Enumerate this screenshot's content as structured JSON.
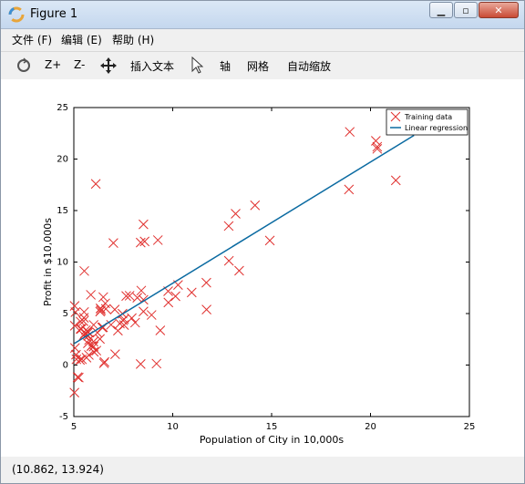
{
  "window": {
    "title": "Figure 1"
  },
  "menu": [
    {
      "label": "文件 (F)"
    },
    {
      "label": "编辑 (E)"
    },
    {
      "label": "帮助 (H)"
    }
  ],
  "toolbar": {
    "zoom_in": "Z+",
    "zoom_out": "Z-",
    "insert_text": "插入文本",
    "axes": "轴",
    "grid": "网格",
    "autoscale": "自动缩放"
  },
  "status": {
    "coords": "(10.862, 13.924)"
  },
  "colors": {
    "training": "#e0302e",
    "regression": "#0a6aa1"
  },
  "chart_data": {
    "type": "scatter",
    "xlabel": "Population of City in 10,000s",
    "ylabel": "Profit in $10,000s",
    "xlim": [
      5,
      25
    ],
    "ylim": [
      -5,
      25
    ],
    "xticks": [
      5,
      10,
      15,
      20,
      25
    ],
    "yticks": [
      -5,
      0,
      5,
      10,
      15,
      20,
      25
    ],
    "legend_position": "top-right",
    "series": [
      {
        "name": "Training data",
        "kind": "scatter",
        "marker": "x",
        "points": [
          [
            6.11,
            17.59
          ],
          [
            5.53,
            9.13
          ],
          [
            8.52,
            13.66
          ],
          [
            7.0,
            11.85
          ],
          [
            5.86,
            6.82
          ],
          [
            8.38,
            11.89
          ],
          [
            7.48,
            4.35
          ],
          [
            8.58,
            12.0
          ],
          [
            6.49,
            6.6
          ],
          [
            5.05,
            3.82
          ],
          [
            5.71,
            3.25
          ],
          [
            14.16,
            15.51
          ],
          [
            5.73,
            3.16
          ],
          [
            8.41,
            7.23
          ],
          [
            5.64,
            0.72
          ],
          [
            5.38,
            3.51
          ],
          [
            6.37,
            5.3
          ],
          [
            5.13,
            0.56
          ],
          [
            6.43,
            3.65
          ],
          [
            7.07,
            5.39
          ],
          [
            6.19,
            3.14
          ],
          [
            20.27,
            21.77
          ],
          [
            5.49,
            4.26
          ],
          [
            6.33,
            5.19
          ],
          [
            5.56,
            3.08
          ],
          [
            18.95,
            22.64
          ],
          [
            12.83,
            13.5
          ],
          [
            10.96,
            7.05
          ],
          [
            13.18,
            14.69
          ],
          [
            22.2,
            24.15
          ],
          [
            5.25,
            -1.22
          ],
          [
            6.59,
            5.99
          ],
          [
            9.25,
            12.13
          ],
          [
            5.89,
            1.85
          ],
          [
            8.21,
            6.54
          ],
          [
            7.93,
            4.56
          ],
          [
            8.1,
            4.12
          ],
          [
            5.61,
            3.39
          ],
          [
            12.84,
            10.12
          ],
          [
            6.35,
            5.5
          ],
          [
            5.41,
            0.56
          ],
          [
            6.88,
            3.91
          ],
          [
            11.71,
            5.39
          ],
          [
            5.77,
            2.44
          ],
          [
            7.82,
            6.73
          ],
          [
            7.09,
            1.05
          ],
          [
            5.08,
            5.13
          ],
          [
            5.89,
            1.84
          ],
          [
            20.34,
            20.99
          ],
          [
            7.46,
            4.99
          ],
          [
            20.34,
            21.2
          ],
          [
            10.14,
            6.68
          ],
          [
            7.33,
            4.03
          ],
          [
            6.01,
            1.28
          ],
          [
            7.23,
            3.34
          ],
          [
            5.03,
            -2.68
          ],
          [
            6.55,
            0.3
          ],
          [
            7.54,
            3.88
          ],
          [
            5.04,
            5.74
          ],
          [
            10.27,
            7.78
          ],
          [
            5.11,
            1.01
          ],
          [
            5.73,
            2.84
          ],
          [
            5.19,
            -1.17
          ],
          [
            6.36,
            5.48
          ],
          [
            9.77,
            7.17
          ],
          [
            6.52,
            0.17
          ],
          [
            8.52,
            5.2
          ],
          [
            9.18,
            0.14
          ],
          [
            6.0,
            1.79
          ],
          [
            5.52,
            5.15
          ],
          [
            5.06,
            1.66
          ],
          [
            5.71,
            2.11
          ],
          [
            8.52,
            6.34
          ],
          [
            7.54,
            4.44
          ],
          [
            9.37,
            3.36
          ],
          [
            6.48,
            3.66
          ],
          [
            5.34,
            4.22
          ],
          [
            5.51,
            4.59
          ],
          [
            21.28,
            17.93
          ],
          [
            18.91,
            17.05
          ],
          [
            9.78,
            6.07
          ],
          [
            5.99,
            2.27
          ],
          [
            13.36,
            9.16
          ],
          [
            14.91,
            12.09
          ],
          [
            11.7,
            8.0
          ],
          [
            8.38,
            0.1
          ],
          [
            7.65,
            6.7
          ],
          [
            8.93,
            4.86
          ],
          [
            6.32,
            2.53
          ],
          [
            5.31,
            0.5
          ],
          [
            5.34,
            3.52
          ],
          [
            6.0,
            3.9
          ],
          [
            5.5,
            2.9
          ],
          [
            5.76,
            0.98
          ],
          [
            6.14,
            1.4
          ],
          [
            6.62,
            5.45
          ]
        ]
      },
      {
        "name": "Linear regression",
        "kind": "line",
        "points": [
          [
            5.03,
            2.1
          ],
          [
            22.2,
            22.3
          ]
        ]
      }
    ]
  }
}
